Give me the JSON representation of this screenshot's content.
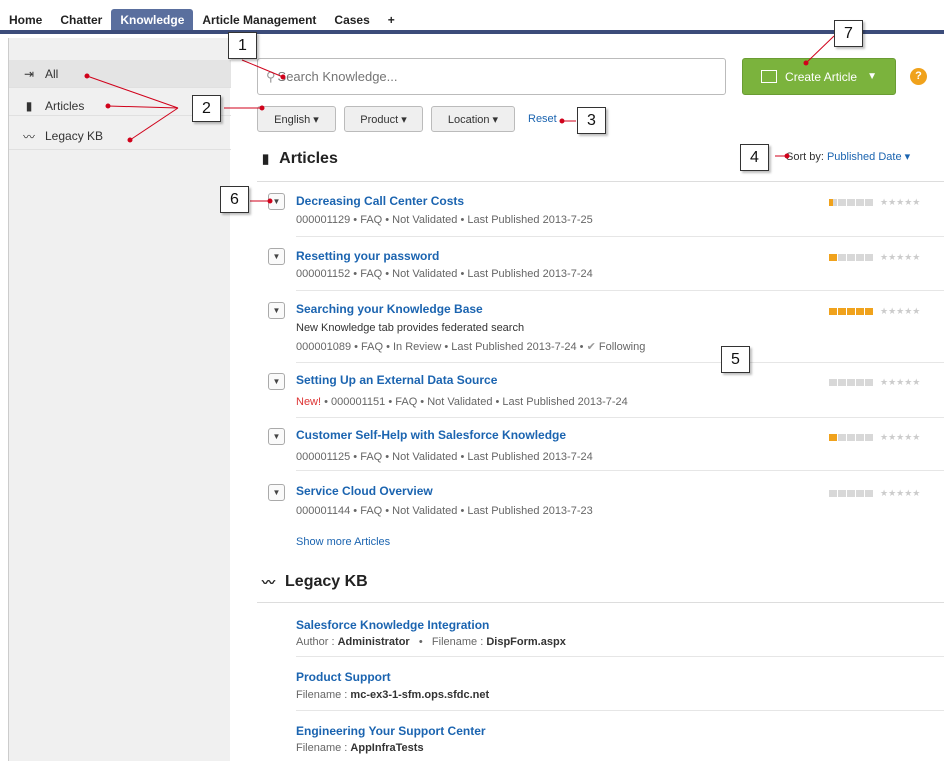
{
  "nav": {
    "tabs": [
      {
        "label": "Home"
      },
      {
        "label": "Chatter"
      },
      {
        "label": "Knowledge"
      },
      {
        "label": "Article Management"
      },
      {
        "label": "Cases"
      },
      {
        "label": "+"
      }
    ],
    "active_tab": "Knowledge"
  },
  "sidebar": {
    "items": [
      {
        "label": "All",
        "icon": "all-icon"
      },
      {
        "label": "Articles",
        "icon": "book-icon"
      },
      {
        "label": "Legacy KB",
        "icon": "legacy-kb-icon"
      }
    ]
  },
  "search": {
    "placeholder": "Search Knowledge..."
  },
  "create_button": {
    "label": "Create Article"
  },
  "help": {
    "label": "?"
  },
  "filters": [
    {
      "label": "English ▾"
    },
    {
      "label": "Product ▾"
    },
    {
      "label": "Location ▾"
    }
  ],
  "reset_label": "Reset",
  "articles_section": {
    "title": "Articles"
  },
  "sort": {
    "label": "Sort by:",
    "value": "Published Date ▾"
  },
  "articles": [
    {
      "title": "Decreasing Call Center Costs",
      "meta": "000001129 • FAQ • Not Validated • Last Published 2013-7-25",
      "rating": 0.5
    },
    {
      "title": "Resetting your password",
      "meta": "000001152 • FAQ • Not Validated • Last Published 2013-7-24",
      "rating": 1
    },
    {
      "title": "Searching your Knowledge Base",
      "summary": "New Knowledge tab provides federated search",
      "meta": "000001089 • FAQ • In Review • Last Published 2013-7-24 •",
      "following": "Following",
      "rating": 5
    },
    {
      "title": "Setting Up an External Data Source",
      "new": "New!",
      "meta": "• 000001151 • FAQ • Not Validated • Last Published 2013-7-24",
      "rating": 0
    },
    {
      "title": "Customer Self-Help with Salesforce Knowledge",
      "meta": "000001125 • FAQ • Not Validated • Last Published 2013-7-24",
      "rating": 1
    },
    {
      "title": "Service Cloud Overview",
      "meta": "000001144 • FAQ • Not Validated • Last Published 2013-7-23",
      "rating": 0
    }
  ],
  "show_more": "Show more Articles",
  "legacy_section": {
    "title": "Legacy KB"
  },
  "legacy": [
    {
      "title": "Salesforce Knowledge Integration",
      "author_label": "Author :",
      "author": "Administrator",
      "sep": "  •  ",
      "filename_label": "Filename :",
      "filename": "DispForm.aspx"
    },
    {
      "title": "Product Support",
      "filename_label": "Filename :",
      "filename": "mc-ex3-1-sfm.ops.sfdc.net"
    },
    {
      "title": "Engineering Your Support Center",
      "filename_label": "Filename :",
      "filename": "AppInfraTests"
    }
  ],
  "callouts": [
    "1",
    "2",
    "3",
    "4",
    "5",
    "6",
    "7"
  ],
  "colors": {
    "accent": "#1b64b0",
    "create": "#7bb33d",
    "rating": "#f0a21c",
    "nav": "#5a6f9e",
    "annotation": "#d0021b"
  }
}
